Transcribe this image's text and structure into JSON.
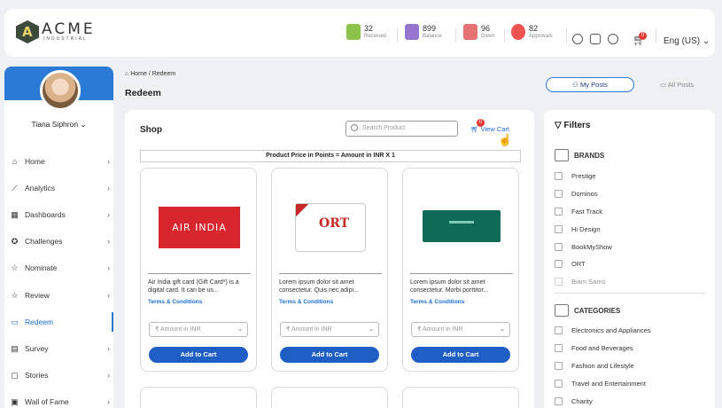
{
  "header": {
    "logo_title": "ACME",
    "logo_sub": "INDUSTRIAL",
    "stats": [
      {
        "value": "32",
        "label": "Received",
        "color": "#8bc34a"
      },
      {
        "value": "899",
        "label": "Balance",
        "color": "#9575cd"
      },
      {
        "value": "96",
        "label": "Given",
        "color": "#e57373"
      },
      {
        "value": "82",
        "label": "Approvals",
        "color": "#ef5350"
      }
    ],
    "cart_badge": "0",
    "language": "Eng (US) ⌄"
  },
  "sidebar": {
    "user_name": "Tiana Siphron ⌄",
    "items": [
      {
        "label": "Home",
        "icon": "⌂"
      },
      {
        "label": "Analytics",
        "icon": "⟋"
      },
      {
        "label": "Dashboards",
        "icon": "▦"
      },
      {
        "label": "Challenges",
        "icon": "✪"
      },
      {
        "label": "Nominate",
        "icon": "☆"
      },
      {
        "label": "Review",
        "icon": "☆"
      },
      {
        "label": "Redeem",
        "icon": "▭"
      },
      {
        "label": "Survey",
        "icon": "▤"
      },
      {
        "label": "Stories",
        "icon": "▢"
      },
      {
        "label": "Wall of Fame",
        "icon": "▣"
      }
    ]
  },
  "breadcrumb": {
    "home": "Home",
    "current": "Redeem",
    "sep": " / "
  },
  "page_title": "Redeem",
  "tabs": {
    "my_posts": "My Posts",
    "all_posts": "All Posts"
  },
  "shop": {
    "title": "Shop",
    "search_placeholder": "Search Product",
    "view_cart": "View Cart",
    "cart_count": "0",
    "price_note": "Product Price in Points = Amount in INR X 1",
    "products": [
      {
        "desc": "Air India gift card (Gift Card*) is a digital card. It can be us...",
        "terms": "Terms & Conditions",
        "amount_placeholder": "₹  Amount in INR",
        "button": "Add to Cart",
        "img_text": "AIR INDIA",
        "img_color": "#d7262e"
      },
      {
        "desc": "Lorem ipsum dolor sit amet consectetur. Quis nec adipi...",
        "terms": "Terms & Conditions",
        "amount_placeholder": "₹  Amount in INR",
        "button": "Add to Cart",
        "img_text": "ORT",
        "img_color": "#ffffff"
      },
      {
        "desc": "Lorem ipsum dolor sit amet consectetur. Morbi porttitor...",
        "terms": "Terms & Conditions",
        "amount_placeholder": "₹  Amount in INR",
        "button": "Add to Cart",
        "img_text": "",
        "img_color": "#0f6b58"
      }
    ]
  },
  "filters": {
    "title": "Filters",
    "brands_title": "BRANDS",
    "brands": [
      "Prestige",
      "Dominos",
      "Fast Track",
      "Hi Design",
      "BookMyShow",
      "ORT",
      "Biam Sams"
    ],
    "categories_title": "CATEGORIES",
    "categories": [
      "Electronics and Appliances",
      "Food and Beverages",
      "Fashion and Lifestyle",
      "Travel and Entertainment",
      "Charity"
    ]
  }
}
